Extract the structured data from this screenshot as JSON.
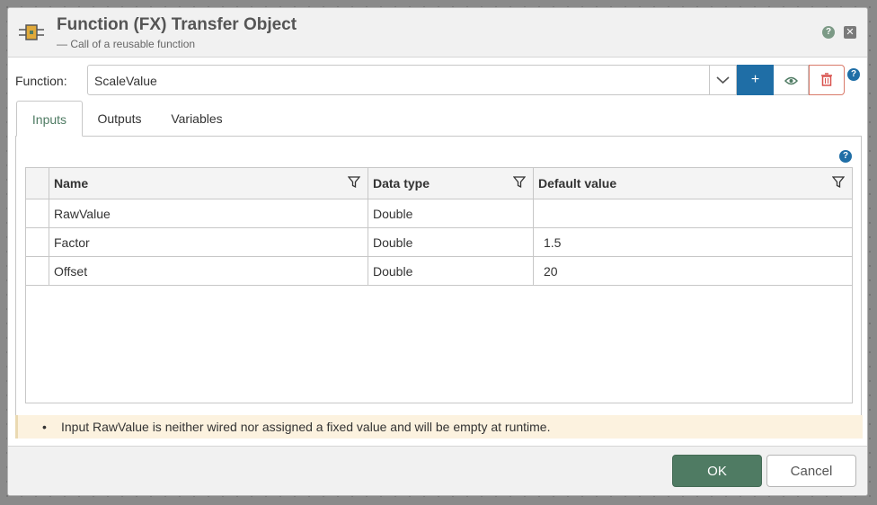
{
  "header": {
    "title": "Function (FX) Transfer Object",
    "subtitle": "— Call of a reusable function",
    "help_label": "?",
    "close_label": "✕"
  },
  "function_row": {
    "label": "Function:",
    "value": "ScaleValue",
    "add_label": "+",
    "help_label": "?"
  },
  "tabs": [
    {
      "label": "Inputs",
      "active": true
    },
    {
      "label": "Outputs",
      "active": false
    },
    {
      "label": "Variables",
      "active": false
    }
  ],
  "panel": {
    "help_label": "?"
  },
  "table": {
    "columns": [
      "Name",
      "Data type",
      "Default value"
    ],
    "rows": [
      {
        "name": "RawValue",
        "type": "Double",
        "default": ""
      },
      {
        "name": "Factor",
        "type": "Double",
        "default": "1.5"
      },
      {
        "name": "Offset",
        "type": "Double",
        "default": "20"
      }
    ]
  },
  "warning": {
    "bullet": "•",
    "message": "Input RawValue is neither wired nor assigned a fixed value and will be empty at runtime."
  },
  "footer": {
    "ok_label": "OK",
    "cancel_label": "Cancel"
  },
  "colors": {
    "primary_green": "#4f7b63",
    "accent_blue": "#1f6ea6",
    "delete_red": "#d9534f",
    "warning_bg": "#fcf2df"
  }
}
